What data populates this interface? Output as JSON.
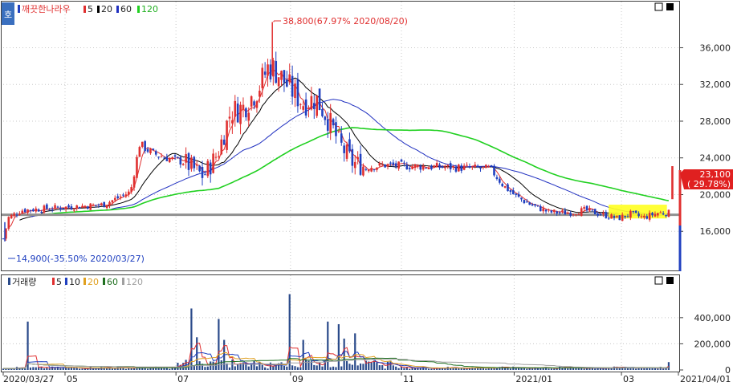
{
  "colors": {
    "up": "#e03030",
    "down": "#2040c0",
    "ma5": "#e03030",
    "ma20": "#000000",
    "ma60": "#2030c0",
    "ma120": "#20d020",
    "vma5": "#e03030",
    "vma10": "#2040c0",
    "vma20": "#e0a020",
    "vma60": "#207020",
    "vma120": "#a0a0a0",
    "volume": "#2a4a8a",
    "highlight": "#ffff20",
    "hline": "#909090",
    "grid": "#c8c8c8",
    "price_badge_bg": "#e02020"
  },
  "price_panel": {
    "legend": {
      "name": "깨끗한나라우",
      "items": [
        {
          "label": "5",
          "color_key": "ma5"
        },
        {
          "label": "20",
          "color_key": "ma20"
        },
        {
          "label": "60",
          "color_key": "ma60"
        },
        {
          "label": "120",
          "color_key": "ma120"
        }
      ]
    },
    "max_annotation": "38,800(67.97% 2020/08/20)",
    "min_annotation": "14,900(-35.50% 2020/03/27)",
    "current_price": "23,100",
    "current_change": "( 29.78%)",
    "side_icon": "호"
  },
  "volume_panel": {
    "legend": {
      "name": "거래량",
      "items": [
        {
          "label": "5",
          "color_key": "vma5"
        },
        {
          "label": "10",
          "color_key": "vma10"
        },
        {
          "label": "20",
          "color_key": "vma20"
        },
        {
          "label": "60",
          "color_key": "vma60"
        },
        {
          "label": "120",
          "color_key": "vma120"
        }
      ]
    }
  },
  "chart_data": {
    "type": "candlestick",
    "price_axis": {
      "ticks": [
        "36,000",
        "32,000",
        "28,000",
        "24,000",
        "20,000",
        "16,000"
      ],
      "tick_values": [
        36000,
        32000,
        28000,
        24000,
        20000,
        16000
      ],
      "range": [
        12000,
        40500
      ]
    },
    "volume_axis": {
      "ticks": [
        "400,000",
        "200,000",
        "0"
      ],
      "tick_values": [
        400000,
        200000,
        0
      ],
      "range": [
        0,
        620000
      ]
    },
    "x_labels": [
      "2020/03/27",
      "05",
      "07",
      "09",
      "11",
      "2021/01",
      "03",
      "2021/04/01"
    ],
    "x_label_days": [
      0,
      34,
      95,
      158,
      219,
      281,
      340,
      370
    ],
    "reference_price": 17800,
    "price_anchors": [
      {
        "d": 0,
        "p": 15200
      },
      {
        "d": 3,
        "p": 17500
      },
      {
        "d": 10,
        "p": 18300
      },
      {
        "d": 25,
        "p": 18500
      },
      {
        "d": 40,
        "p": 18700
      },
      {
        "d": 55,
        "p": 18900
      },
      {
        "d": 70,
        "p": 20300
      },
      {
        "d": 75,
        "p": 25500
      },
      {
        "d": 82,
        "p": 24500
      },
      {
        "d": 90,
        "p": 24000
      },
      {
        "d": 100,
        "p": 23500
      },
      {
        "d": 110,
        "p": 22000
      },
      {
        "d": 118,
        "p": 24500
      },
      {
        "d": 125,
        "p": 29000
      },
      {
        "d": 132,
        "p": 29500
      },
      {
        "d": 140,
        "p": 31500
      },
      {
        "d": 146,
        "p": 34000
      },
      {
        "d": 150,
        "p": 33500
      },
      {
        "d": 158,
        "p": 31500
      },
      {
        "d": 165,
        "p": 30000
      },
      {
        "d": 172,
        "p": 30500
      },
      {
        "d": 178,
        "p": 28500
      },
      {
        "d": 185,
        "p": 25500
      },
      {
        "d": 192,
        "p": 23500
      },
      {
        "d": 200,
        "p": 23000
      },
      {
        "d": 210,
        "p": 23200
      },
      {
        "d": 225,
        "p": 23100
      },
      {
        "d": 240,
        "p": 23000
      },
      {
        "d": 255,
        "p": 22900
      },
      {
        "d": 268,
        "p": 22800
      },
      {
        "d": 275,
        "p": 21000
      },
      {
        "d": 282,
        "p": 19800
      },
      {
        "d": 290,
        "p": 18900
      },
      {
        "d": 300,
        "p": 18100
      },
      {
        "d": 310,
        "p": 18000
      },
      {
        "d": 320,
        "p": 18300
      },
      {
        "d": 330,
        "p": 17800
      },
      {
        "d": 338,
        "p": 17400
      },
      {
        "d": 345,
        "p": 17900
      },
      {
        "d": 352,
        "p": 17500
      },
      {
        "d": 360,
        "p": 18000
      },
      {
        "d": 366,
        "p": 18000
      },
      {
        "d": 368,
        "p": 23100
      }
    ],
    "highlight_box": {
      "d_start": 333,
      "d_end": 365,
      "p_low": 17400,
      "p_high": 18900
    },
    "volume_spikes": [
      {
        "d": 13,
        "v": 370000
      },
      {
        "d": 103,
        "v": 470000
      },
      {
        "d": 107,
        "v": 250000
      },
      {
        "d": 118,
        "v": 390000
      },
      {
        "d": 121,
        "v": 230000
      },
      {
        "d": 126,
        "v": 80000
      },
      {
        "d": 158,
        "v": 580000
      },
      {
        "d": 165,
        "v": 230000
      },
      {
        "d": 178,
        "v": 370000
      },
      {
        "d": 184,
        "v": 350000
      },
      {
        "d": 188,
        "v": 240000
      },
      {
        "d": 193,
        "v": 280000
      },
      {
        "d": 200,
        "v": 70000
      },
      {
        "d": 215,
        "v": 35000
      },
      {
        "d": 368,
        "v": 60000
      }
    ]
  }
}
